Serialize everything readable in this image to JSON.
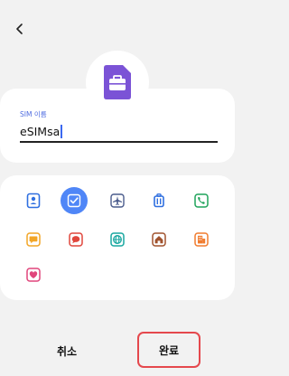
{
  "header": {
    "back_icon": "chevron-left-icon"
  },
  "profile": {
    "hero_icon": "sim-card-briefcase-icon",
    "hero_color": "#7b53d6"
  },
  "name_field": {
    "label": "SIM 이름",
    "value": "eSIMsa"
  },
  "icon_picker": {
    "icons": [
      {
        "name": "person-icon",
        "color": "#2f6fe0",
        "selected": false
      },
      {
        "name": "check-icon",
        "color": "#ffffff",
        "selected": true
      },
      {
        "name": "airplane-icon",
        "color": "#4a5b8c",
        "selected": false
      },
      {
        "name": "luggage-icon",
        "color": "#2f6fe0",
        "selected": false
      },
      {
        "name": "phone-icon",
        "color": "#1fa35a",
        "selected": false
      },
      {
        "name": "chat-icon",
        "color": "#f2a526",
        "selected": false
      },
      {
        "name": "chat-bubble-icon",
        "color": "#e0463c",
        "selected": false
      },
      {
        "name": "globe-icon",
        "color": "#18a7a0",
        "selected": false
      },
      {
        "name": "home-icon",
        "color": "#a0522d",
        "selected": false
      },
      {
        "name": "building-icon",
        "color": "#f07b2e",
        "selected": false
      },
      {
        "name": "heart-icon",
        "color": "#e0457b",
        "selected": false
      }
    ]
  },
  "footer": {
    "cancel_label": "취소",
    "done_label": "완료",
    "highlight_color": "#e5484d"
  }
}
